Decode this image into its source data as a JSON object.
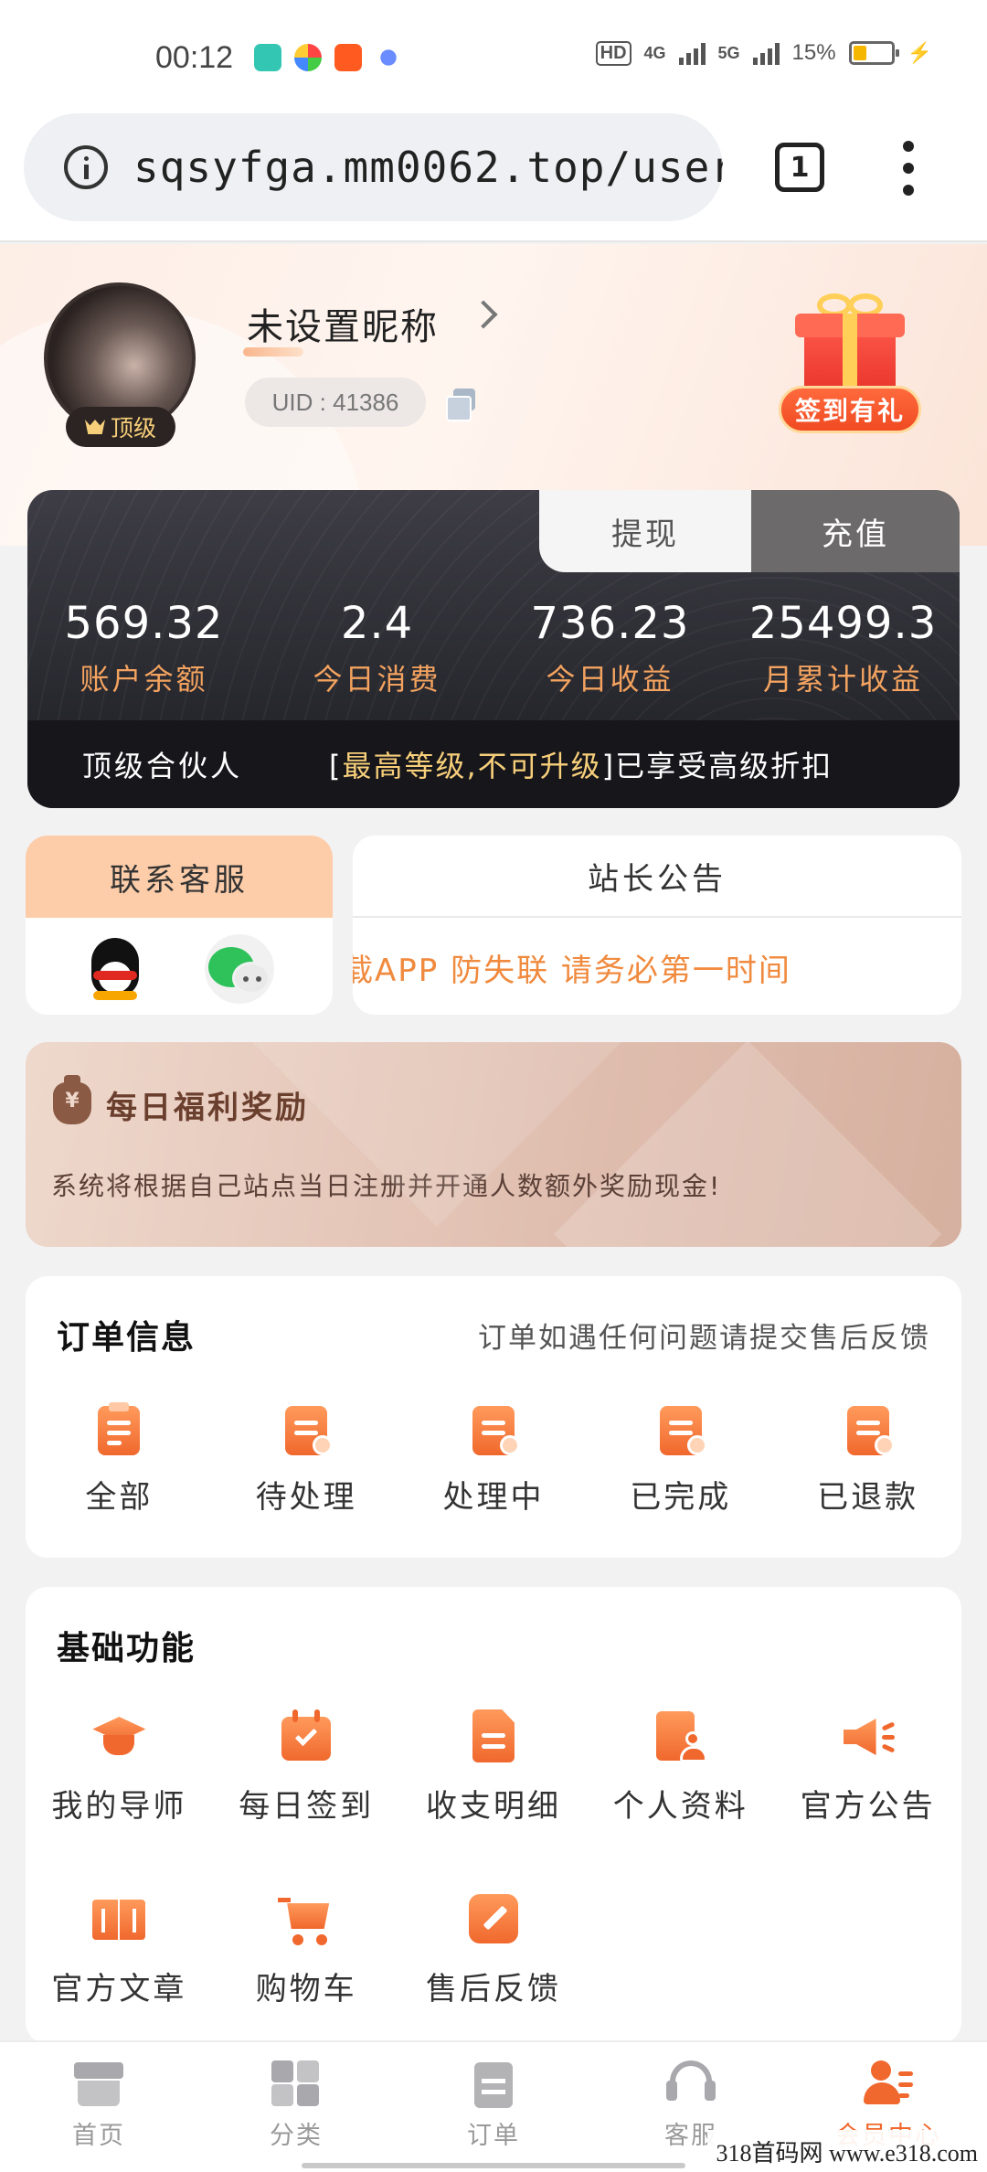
{
  "status_bar": {
    "time": "00:12",
    "network1": "4G",
    "network2": "5G",
    "hd_label": "HD",
    "battery": "15%"
  },
  "browser": {
    "url": "sqsyfga.mm0062.top/user",
    "tab_count": "1"
  },
  "profile": {
    "nickname": "未设置昵称",
    "rank_badge": "顶级",
    "uid": "UID : 41386",
    "checkin_label": "签到有礼"
  },
  "balance": {
    "tab_withdraw": "提现",
    "tab_recharge": "充值",
    "stats": [
      {
        "value": "569.32",
        "label": "账户余额"
      },
      {
        "value": "2.4",
        "label": "今日消费"
      },
      {
        "value": "736.23",
        "label": "今日收益"
      },
      {
        "value": "25499.3",
        "label": "月累计收益"
      }
    ],
    "rank_name": "顶级合伙人",
    "level_open": "[",
    "level_highlight": "最高等级,不可升级",
    "level_close": "]",
    "level_tail": "已享受高级折扣"
  },
  "contact": {
    "title": "联系客服"
  },
  "notice": {
    "title": "站长公告",
    "marquee": "载APP 防失联 请务必第一时间"
  },
  "reward": {
    "title": "每日福利奖励",
    "desc": "系统将根据自己站点当日注册并开通人数额外奖励现金!"
  },
  "orders": {
    "title": "订单信息",
    "hint": "订单如遇任何问题请提交售后反馈",
    "items": [
      {
        "label": "全部",
        "icon": "order-all-icon"
      },
      {
        "label": "待处理",
        "icon": "order-pending-icon"
      },
      {
        "label": "处理中",
        "icon": "order-processing-icon"
      },
      {
        "label": "已完成",
        "icon": "order-completed-icon"
      },
      {
        "label": "已退款",
        "icon": "order-refunded-icon"
      }
    ]
  },
  "functions": {
    "title": "基础功能",
    "items": [
      {
        "label": "我的导师",
        "icon": "mentor-icon"
      },
      {
        "label": "每日签到",
        "icon": "calendar-check-icon"
      },
      {
        "label": "收支明细",
        "icon": "file-detail-icon"
      },
      {
        "label": "个人资料",
        "icon": "profile-doc-icon"
      },
      {
        "label": "官方公告",
        "icon": "megaphone-icon"
      },
      {
        "label": "官方文章",
        "icon": "book-icon"
      },
      {
        "label": "购物车",
        "icon": "cart-icon"
      },
      {
        "label": "售后反馈",
        "icon": "edit-icon"
      }
    ]
  },
  "bottom_nav": {
    "items": [
      {
        "label": "首页",
        "icon": "shop-icon"
      },
      {
        "label": "分类",
        "icon": "category-icon"
      },
      {
        "label": "订单",
        "icon": "order-icon"
      },
      {
        "label": "客服",
        "icon": "headset-icon"
      },
      {
        "label": "会员中心",
        "icon": "member-icon"
      }
    ],
    "active": "会员中心"
  },
  "watermark": "318首码网 www.e318.com",
  "colors": {
    "accent": "#f0682d",
    "gold": "#f7cf7a",
    "stat_label": "#f3a35f"
  }
}
